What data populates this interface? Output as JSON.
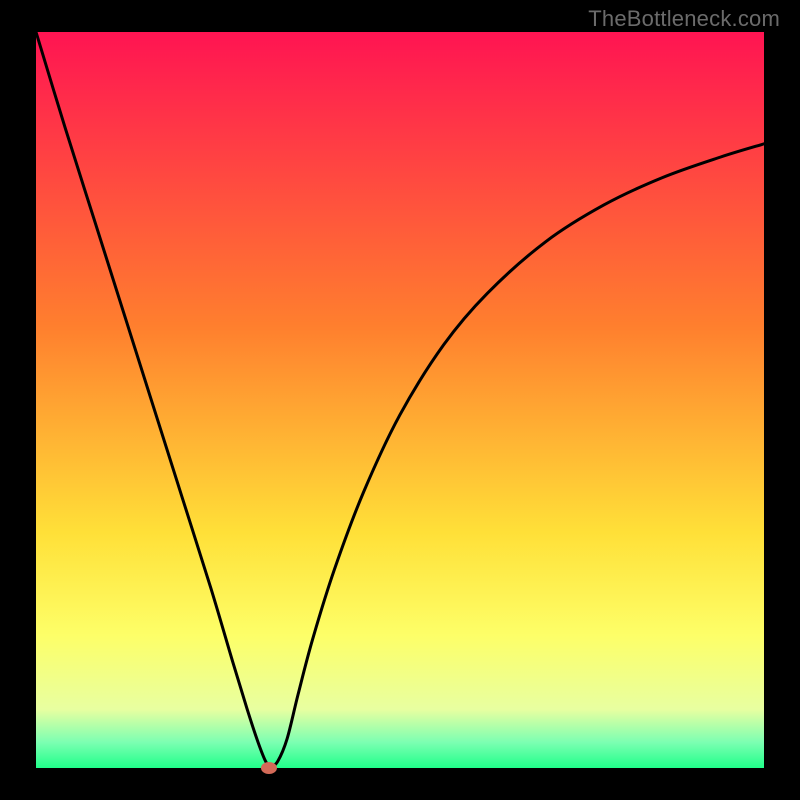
{
  "watermark": "TheBottleneck.com",
  "chart_data": {
    "type": "line",
    "title": "",
    "xlabel": "",
    "ylabel": "",
    "xlim": [
      0,
      100
    ],
    "ylim": [
      0,
      100
    ],
    "grid": false,
    "legend": false,
    "background_gradient": {
      "stops": [
        {
          "pos": 0.0,
          "color": "#ff1452"
        },
        {
          "pos": 0.4,
          "color": "#ff7f2e"
        },
        {
          "pos": 0.68,
          "color": "#ffe038"
        },
        {
          "pos": 0.82,
          "color": "#fdff68"
        },
        {
          "pos": 0.92,
          "color": "#e8ffa0"
        },
        {
          "pos": 0.965,
          "color": "#7cffb2"
        },
        {
          "pos": 1.0,
          "color": "#20ff8a"
        }
      ]
    },
    "marker": {
      "x": 32,
      "y": 0,
      "color": "#d36a58"
    },
    "series": [
      {
        "name": "bottleneck-curve",
        "x": [
          0,
          4,
          8,
          12,
          16,
          20,
          24,
          27,
          29,
          30.5,
          31.6,
          32.3,
          33.2,
          34.5,
          36,
          38,
          41,
          45,
          50,
          56,
          62,
          70,
          78,
          86,
          94,
          100
        ],
        "y": [
          100,
          87,
          74.5,
          62,
          49.5,
          37,
          24.5,
          14.5,
          8,
          3.5,
          0.8,
          0.3,
          0.9,
          4,
          10,
          17.5,
          27,
          37.5,
          48,
          57.5,
          64.5,
          71.5,
          76.5,
          80.2,
          83,
          84.8
        ]
      }
    ]
  }
}
